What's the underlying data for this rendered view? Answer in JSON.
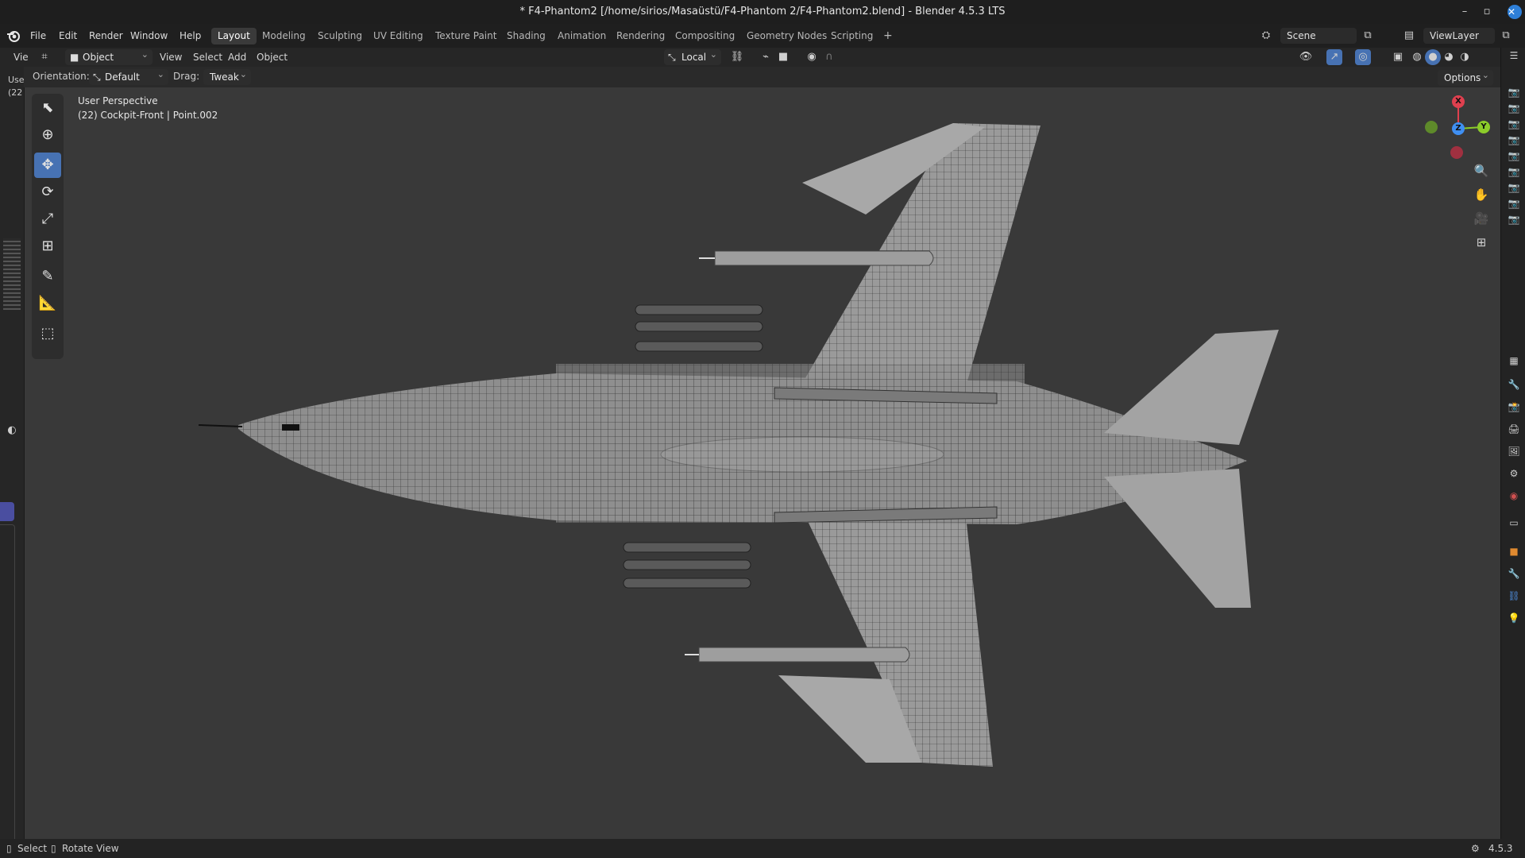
{
  "window": {
    "title": "* F4-Phantom2 [/home/sirios/Masaüstü/F4-Phantom 2/F4-Phantom2.blend] - Blender 4.5.3 LTS",
    "controls": [
      "–",
      "▫",
      "▢",
      "✕"
    ]
  },
  "menu": [
    "File",
    "Edit",
    "Render",
    "Window",
    "Help"
  ],
  "workspaces": [
    "Layout",
    "Modeling",
    "Sculpting",
    "UV Editing",
    "Texture Paint",
    "Shading",
    "Animation",
    "Rendering",
    "Compositing",
    "Geometry Nodes",
    "Scripting"
  ],
  "active_workspace": "Layout",
  "add_workspace": "+",
  "scene": {
    "label": "Scene"
  },
  "view_layer": {
    "label": "ViewLayer"
  },
  "header": {
    "left_cut": "Vie",
    "mode": "Object Mode",
    "items": [
      "View",
      "Select",
      "Add",
      "Object"
    ],
    "transform_orientation": "Local"
  },
  "tool_settings": {
    "orientation_label": "Orientation:",
    "orientation_value": "Default",
    "drag_label": "Drag:",
    "drag_value": "Tweak",
    "options": "Options"
  },
  "viewport_info": {
    "line1": "User Perspective",
    "line2": "(22) Cockpit-Front | Point.002"
  },
  "left_strip_text": [
    "Use",
    "(22"
  ],
  "gizmo": {
    "x": "X",
    "y": "Y",
    "z": "Z"
  },
  "status": {
    "select": "Select",
    "rotate": "Rotate View",
    "version": "4.5.3"
  },
  "colors": {
    "active": "#4772b3",
    "axis_x": "#e0404f",
    "axis_y": "#8ccc2a",
    "axis_z": "#3f8ff2",
    "bg": "#393939"
  }
}
